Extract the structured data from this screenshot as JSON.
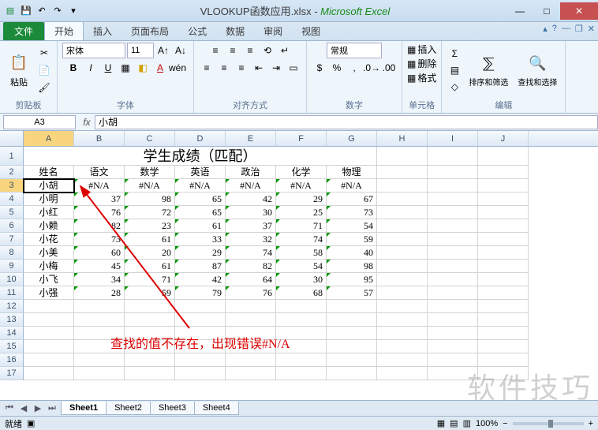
{
  "title": {
    "filename": "VLOOKUP函数应用.xlsx",
    "app": "Microsoft Excel",
    "sep": " - "
  },
  "tabs": {
    "file": "文件",
    "home": "开始",
    "insert": "插入",
    "layout": "页面布局",
    "formulas": "公式",
    "data": "数据",
    "review": "审阅",
    "view": "视图"
  },
  "ribbon": {
    "clipboard": {
      "label": "剪贴板",
      "paste": "粘贴"
    },
    "font": {
      "label": "字体",
      "name": "宋体",
      "size": "11"
    },
    "align": {
      "label": "对齐方式",
      "general": "常规"
    },
    "number": {
      "label": "数字"
    },
    "cells": {
      "label": "单元格",
      "insert": "插入",
      "delete": "删除",
      "format": "格式"
    },
    "editing": {
      "label": "编辑",
      "sort": "排序和筛选",
      "find": "查找和选择"
    }
  },
  "namebox": "A3",
  "formula": "小胡",
  "columns": [
    "A",
    "B",
    "C",
    "D",
    "E",
    "F",
    "G",
    "H",
    "I",
    "J"
  ],
  "chart_data": {
    "type": "table",
    "title": "学生成绩（匹配）",
    "headers": [
      "姓名",
      "语文",
      "数学",
      "英语",
      "政治",
      "化学",
      "物理"
    ],
    "rows": [
      {
        "name": "小胡",
        "v": [
          "#N/A",
          "#N/A",
          "#N/A",
          "#N/A",
          "#N/A",
          "#N/A"
        ]
      },
      {
        "name": "小明",
        "v": [
          "37",
          "98",
          "65",
          "42",
          "29",
          "67"
        ]
      },
      {
        "name": "小红",
        "v": [
          "76",
          "72",
          "65",
          "30",
          "25",
          "73"
        ]
      },
      {
        "name": "小赖",
        "v": [
          "82",
          "23",
          "61",
          "37",
          "71",
          "54"
        ]
      },
      {
        "name": "小花",
        "v": [
          "73",
          "61",
          "33",
          "32",
          "74",
          "59"
        ]
      },
      {
        "name": "小美",
        "v": [
          "60",
          "20",
          "29",
          "74",
          "58",
          "40"
        ]
      },
      {
        "name": "小梅",
        "v": [
          "45",
          "61",
          "87",
          "82",
          "54",
          "98"
        ]
      },
      {
        "name": "小飞",
        "v": [
          "34",
          "71",
          "42",
          "64",
          "30",
          "95"
        ]
      },
      {
        "name": "小强",
        "v": [
          "28",
          "59",
          "79",
          "76",
          "68",
          "57"
        ]
      }
    ]
  },
  "annotation": "查找的值不存在，出现错误#N/A",
  "watermark": "软件技巧",
  "sheets": [
    "Sheet1",
    "Sheet2",
    "Sheet3",
    "Sheet4"
  ],
  "status": {
    "ready": "就绪",
    "zoom": "100%"
  }
}
